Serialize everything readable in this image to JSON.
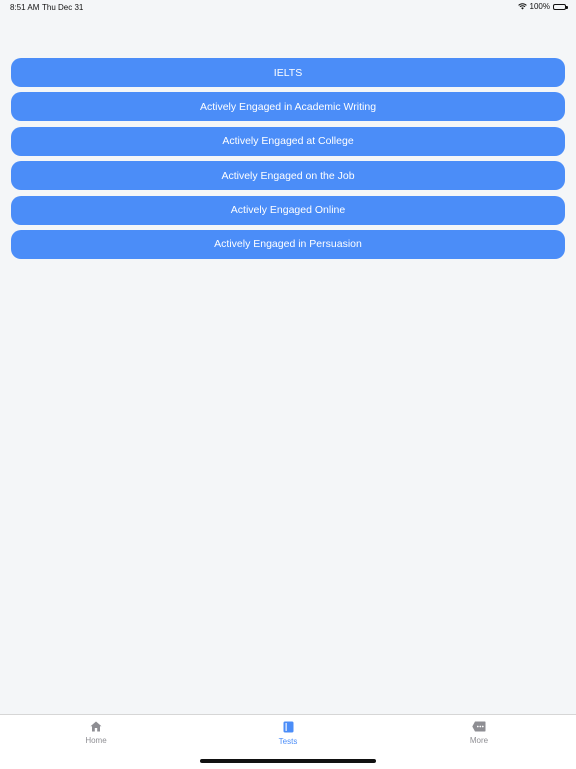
{
  "status_bar": {
    "time": "8:51 AM",
    "date": "Thu Dec 31",
    "battery": "100%"
  },
  "tests": [
    {
      "label": "IELTS"
    },
    {
      "label": "Actively Engaged in Academic Writing"
    },
    {
      "label": "Actively Engaged at College"
    },
    {
      "label": "Actively Engaged on the Job"
    },
    {
      "label": "Actively Engaged Online"
    },
    {
      "label": "Actively Engaged in Persuasion"
    }
  ],
  "tab_bar": {
    "items": [
      {
        "label": "Home",
        "icon": "home-icon"
      },
      {
        "label": "Tests",
        "icon": "book-icon",
        "active": true
      },
      {
        "label": "More",
        "icon": "more-icon"
      }
    ],
    "active_color": "#4b8df8"
  },
  "colors": {
    "button_bg": "#4b8df8",
    "page_bg": "#f4f6f8"
  }
}
